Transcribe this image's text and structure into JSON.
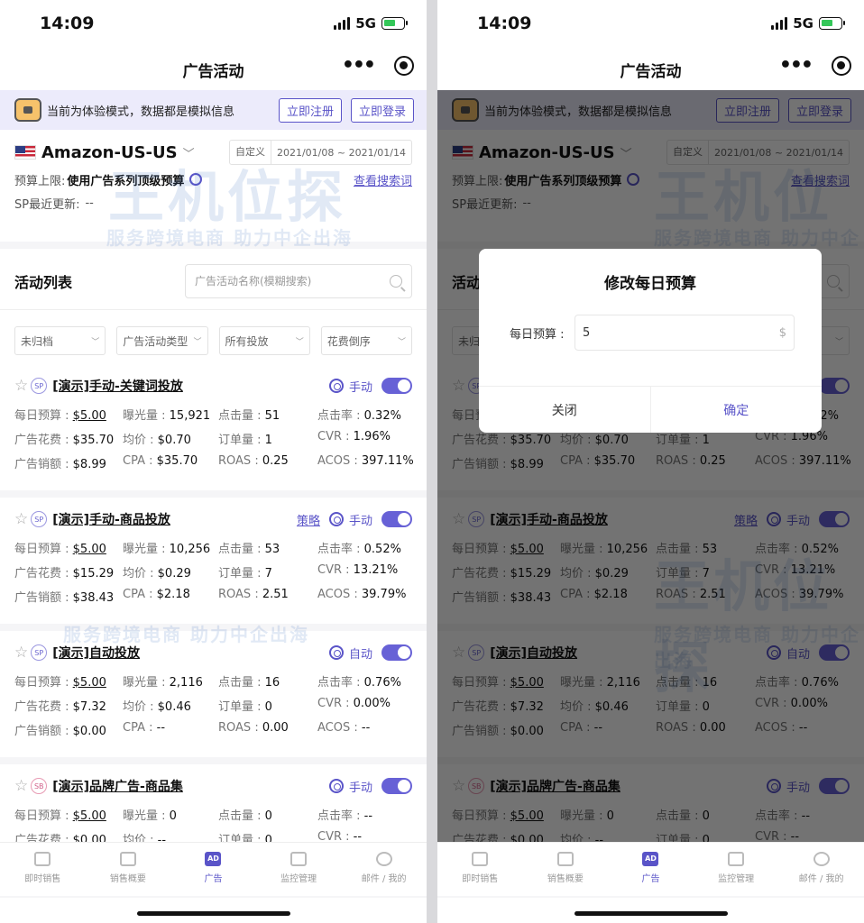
{
  "status": {
    "time": "14:09",
    "network": "5G"
  },
  "nav": {
    "title": "广告活动"
  },
  "banner": {
    "text": "当前为体验模式，数据都是模拟信息",
    "register": "立即注册",
    "login": "立即登录"
  },
  "store": {
    "name": "Amazon-US-US",
    "date_mode": "自定义",
    "date_range": "2021/01/08 ~ 2021/01/14",
    "budget_label": "预算上限:",
    "budget_value": "使用广告系列顶级预算",
    "view_search_terms": "查看搜索词",
    "sp_update_label": "SP最近更新:",
    "sp_update_value": "--"
  },
  "list": {
    "title": "活动列表",
    "search_placeholder": "广告活动名称(模糊搜索)",
    "filters": [
      "未归档",
      "广告活动类型",
      "所有投放",
      "花费倒序"
    ]
  },
  "campaigns": [
    {
      "badge": "SP",
      "name": "[演示]手动-关键词投放",
      "strategy": "",
      "mode": "手动",
      "daily_budget": "$5.00",
      "impressions": "15,921",
      "clicks": "51",
      "ctr": "0.32%",
      "spend": "$35.70",
      "cpc": "$0.70",
      "orders": "1",
      "cvr": "1.96%",
      "sales": "$8.99",
      "cpa": "$35.70",
      "roas": "0.25",
      "acos": "397.11%"
    },
    {
      "badge": "SP",
      "name": "[演示]手动-商品投放",
      "strategy": "策略",
      "mode": "手动",
      "daily_budget": "$5.00",
      "impressions": "10,256",
      "clicks": "53",
      "ctr": "0.52%",
      "spend": "$15.29",
      "cpc": "$0.29",
      "orders": "7",
      "cvr": "13.21%",
      "sales": "$38.43",
      "cpa": "$2.18",
      "roas": "2.51",
      "acos": "39.79%"
    },
    {
      "badge": "SP",
      "name": "[演示]自动投放",
      "strategy": "",
      "mode": "自动",
      "daily_budget": "$5.00",
      "impressions": "2,116",
      "clicks": "16",
      "ctr": "0.76%",
      "spend": "$7.32",
      "cpc": "$0.46",
      "orders": "0",
      "cvr": "0.00%",
      "sales": "$0.00",
      "cpa": "--",
      "roas": "0.00",
      "acos": "--"
    },
    {
      "badge": "SB",
      "name": "[演示]品牌广告-商品集",
      "strategy": "",
      "mode": "手动",
      "daily_budget": "$5.00",
      "impressions": "0",
      "clicks": "0",
      "ctr": "--",
      "spend": "$0.00",
      "cpc": "--",
      "orders": "0",
      "cvr": "--",
      "sales": "",
      "cpa": "",
      "roas": "",
      "acos": ""
    }
  ],
  "metric_labels": {
    "daily_budget": "每日预算 : ",
    "impressions": "曝光量 : ",
    "clicks": "点击量 : ",
    "ctr": "点击率 : ",
    "spend": "广告花费 : ",
    "cpc": "均价 : ",
    "orders": "订单量 : ",
    "cvr": "CVR : ",
    "sales": "广告销额 : ",
    "cpa": "CPA : ",
    "roas": "ROAS : ",
    "acos": "ACOS : "
  },
  "tabs": [
    {
      "label": "即时销售",
      "icon": "chart-icon"
    },
    {
      "label": "销售概要",
      "icon": "bars-icon"
    },
    {
      "label": "广告",
      "icon": "ad-icon",
      "glyph": "AD"
    },
    {
      "label": "监控管理",
      "icon": "monitor-icon"
    },
    {
      "label": "邮件 / 我的",
      "icon": "user-icon"
    }
  ],
  "dialog": {
    "title": "修改每日预算",
    "label": "每日预算 :",
    "value": "5",
    "currency": "$",
    "cancel": "关闭",
    "confirm": "确定"
  },
  "watermark": {
    "brand": "王机位探",
    "slogan": "服务跨境电商 助力中企出海"
  },
  "colors": {
    "accent": "#5a54c8",
    "toggle": "#6761d6",
    "banner_bg": "#ecebfb"
  }
}
